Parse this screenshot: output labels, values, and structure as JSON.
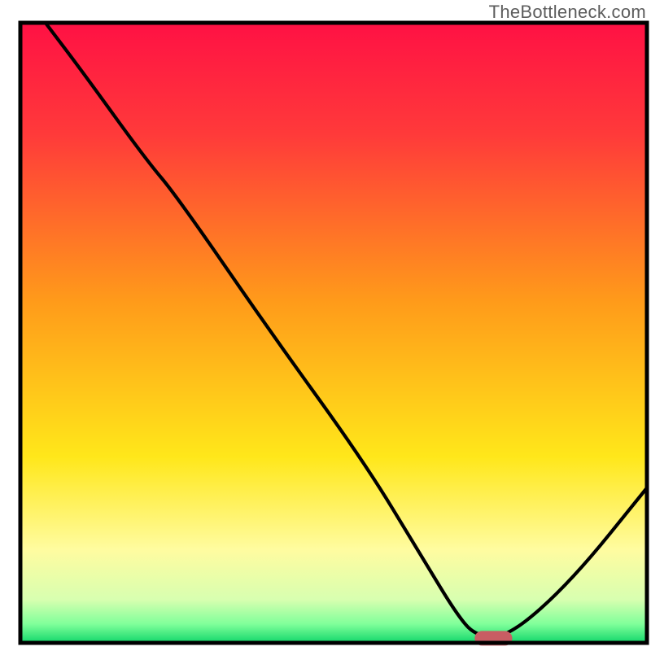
{
  "watermark": "TheBottleneck.com",
  "chart_data": {
    "type": "line",
    "title": "",
    "xlabel": "",
    "ylabel": "",
    "xlim": [
      0,
      100
    ],
    "ylim": [
      0,
      100
    ],
    "x": [
      4,
      10,
      20,
      25,
      40,
      55,
      64,
      70,
      73,
      78,
      88,
      100
    ],
    "values": [
      100,
      92,
      78,
      72,
      50,
      29,
      14,
      4,
      1,
      1,
      10,
      25
    ],
    "optimal_marker": {
      "x_center": 75.5,
      "y": 1.0,
      "width": 6
    },
    "gradient_stops": [
      {
        "pos": 0.0,
        "color": "#ff1144"
      },
      {
        "pos": 0.18,
        "color": "#ff3a3a"
      },
      {
        "pos": 0.45,
        "color": "#ff9b1a"
      },
      {
        "pos": 0.7,
        "color": "#ffe71a"
      },
      {
        "pos": 0.85,
        "color": "#fffca0"
      },
      {
        "pos": 0.93,
        "color": "#d8ffb0"
      },
      {
        "pos": 0.97,
        "color": "#7fff9a"
      },
      {
        "pos": 1.0,
        "color": "#12d66a"
      }
    ],
    "marker_color": "#c85d63",
    "curve_color": "#000000",
    "frame_color": "#000000"
  }
}
